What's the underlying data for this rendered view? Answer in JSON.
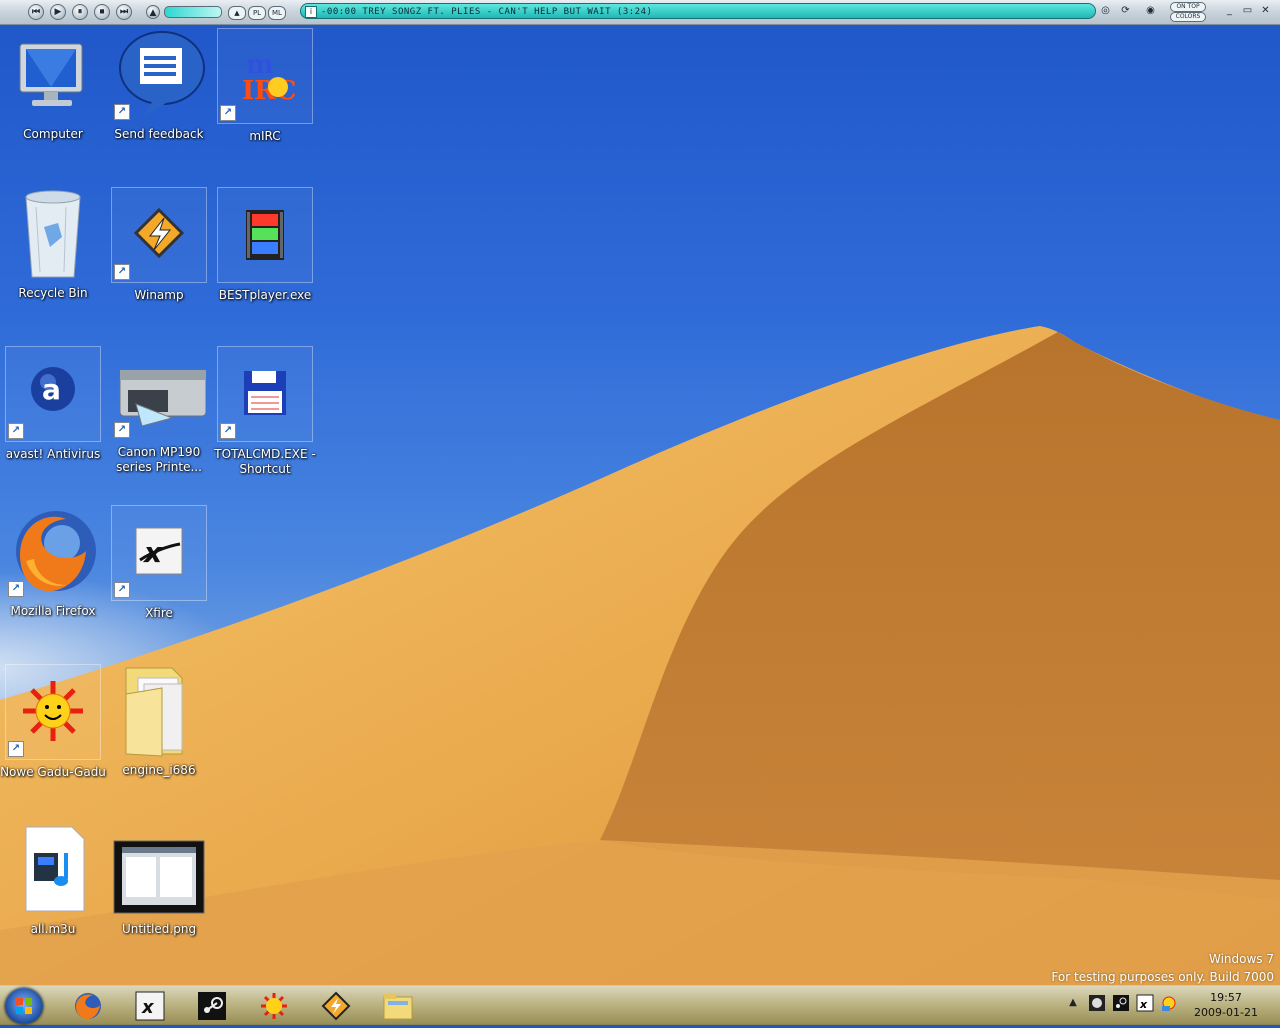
{
  "winamp": {
    "buttons": [
      "⏮",
      "▶",
      "⏸",
      "⏹",
      "⏭"
    ],
    "pills": [
      "PL",
      "ML"
    ],
    "track_text": "-00:00 TREY SONGZ FT. PLIES - CAN'T HELP BUT WAIT (3:24)",
    "right_labels": [
      "ON TOP",
      "COLORS"
    ]
  },
  "desktop": {
    "icons": [
      {
        "label": "Computer",
        "shortcut": false
      },
      {
        "label": "Send feedback",
        "shortcut": true
      },
      {
        "label": "mIRC",
        "shortcut": true
      },
      {
        "label": "Recycle Bin",
        "shortcut": false
      },
      {
        "label": "Winamp",
        "shortcut": true
      },
      {
        "label": "BESTplayer.exe",
        "shortcut": false
      },
      {
        "label": "avast! Antivirus",
        "shortcut": true
      },
      {
        "label": "Canon MP190 series Printe...",
        "shortcut": true
      },
      {
        "label": "TOTALCMD.EXE - Shortcut",
        "shortcut": true
      },
      {
        "label": "Mozilla Firefox",
        "shortcut": true
      },
      {
        "label": "Xfire",
        "shortcut": true
      },
      {
        "label": "Nowe Gadu-Gadu",
        "shortcut": true
      },
      {
        "label": "engine_i686",
        "shortcut": false
      },
      {
        "label": "all.m3u",
        "shortcut": false
      },
      {
        "label": "Untitled.png",
        "shortcut": false
      }
    ]
  },
  "watermark": {
    "line1": "Windows 7",
    "line2": "For testing purposes only. Build 7000"
  },
  "taskbar": {
    "pinned": [
      "firefox-icon",
      "xfire-icon",
      "steam-icon",
      "gadu-gadu-icon",
      "winamp-icon",
      "explorer-icon"
    ],
    "tray": [
      "show-hidden-icons",
      "winamp-tray-icon",
      "steam-tray-icon",
      "xfire-tray-icon",
      "gadu-tray-icon"
    ],
    "time": "19:57",
    "date": "2009-01-21"
  },
  "colors": {
    "sky": "#2f6bd8",
    "sand": "#e8a64a",
    "accent": "#1fb8b4"
  }
}
